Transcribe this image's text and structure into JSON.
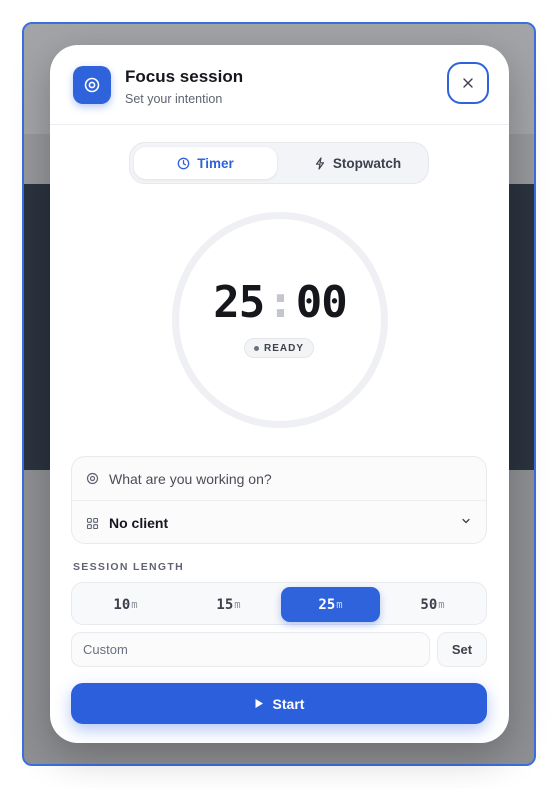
{
  "header": {
    "title": "Focus session",
    "subtitle": "Set your intention",
    "icon": "target-icon",
    "close_icon": "close-icon"
  },
  "mode_toggle": {
    "options": [
      {
        "label": "Timer",
        "icon": "clock-icon",
        "selected": true
      },
      {
        "label": "Stopwatch",
        "icon": "lightning-icon",
        "selected": false
      }
    ]
  },
  "timer": {
    "minutes": "25",
    "separator": ":",
    "seconds": "00",
    "status": "READY"
  },
  "task": {
    "placeholder": "What are you working on?",
    "value": "",
    "icon": "target-icon"
  },
  "client": {
    "value": "No client",
    "icon": "grid-icon",
    "chevron_icon": "chevron-down-icon"
  },
  "session_length": {
    "label": "SESSION LENGTH",
    "unit": "m",
    "options": [
      {
        "value": "10",
        "selected": false
      },
      {
        "value": "15",
        "selected": false
      },
      {
        "value": "25",
        "selected": true
      },
      {
        "value": "50",
        "selected": false
      }
    ]
  },
  "custom": {
    "placeholder": "Custom",
    "set_label": "Set"
  },
  "start": {
    "label": "Start",
    "icon": "play-icon"
  },
  "colors": {
    "accent": "#2f63dc",
    "text": "#15171c",
    "muted": "#5f6470"
  }
}
